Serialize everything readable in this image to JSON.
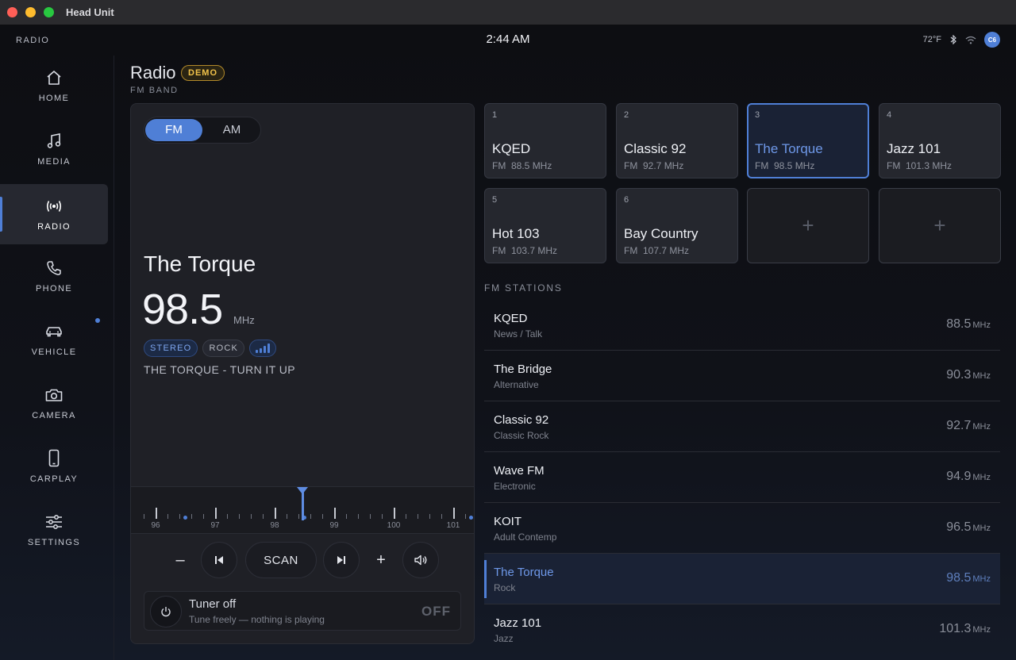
{
  "window": {
    "title": "Head Unit"
  },
  "status": {
    "app": "RADIO",
    "clock": "2:44 AM",
    "temp": "72°F",
    "avatar": "C6"
  },
  "nav": {
    "home": "HOME",
    "media": "MEDIA",
    "radio": "RADIO",
    "phone": "PHONE",
    "vehicle": "VEHICLE",
    "camera": "CAMERA",
    "carplay": "CARPLAY",
    "settings": "SETTINGS",
    "active": "radio"
  },
  "page": {
    "title": "Radio",
    "badge": "DEMO",
    "subtitle": "FM BAND"
  },
  "tuner": {
    "bands": {
      "fm": "FM",
      "am": "AM",
      "selected": "FM"
    },
    "station": "The Torque",
    "frequency": "98.5",
    "unit": "MHz",
    "tags": {
      "stereo": "STEREO",
      "genre": "ROCK"
    },
    "signal_bars": 4,
    "rds": "THE TORQUE - TURN IT UP",
    "dial": {
      "labels": [
        "96",
        "97",
        "98",
        "99",
        "100",
        "101"
      ]
    },
    "controls": {
      "scan": "SCAN",
      "minus": "–",
      "plus": "+"
    },
    "power": {
      "title": "Tuner off",
      "subtitle": "Tune freely — nothing is playing",
      "state": "OFF"
    }
  },
  "presets": [
    {
      "num": "1",
      "name": "KQED",
      "band": "FM",
      "freq": "88.5 MHz",
      "active": false
    },
    {
      "num": "2",
      "name": "Classic 92",
      "band": "FM",
      "freq": "92.7 MHz",
      "active": false
    },
    {
      "num": "3",
      "name": "The Torque",
      "band": "FM",
      "freq": "98.5 MHz",
      "active": true
    },
    {
      "num": "4",
      "name": "Jazz 101",
      "band": "FM",
      "freq": "101.3 MHz",
      "active": false
    },
    {
      "num": "5",
      "name": "Hot 103",
      "band": "FM",
      "freq": "103.7 MHz",
      "active": false
    },
    {
      "num": "6",
      "name": "Bay Country",
      "band": "FM",
      "freq": "107.7 MHz",
      "active": false
    }
  ],
  "empty_preset": {
    "plus": "+"
  },
  "stations": {
    "heading": "FM STATIONS",
    "unit": "MHz",
    "items": [
      {
        "name": "KQED",
        "genre": "News / Talk",
        "freq": "88.5"
      },
      {
        "name": "The Bridge",
        "genre": "Alternative",
        "freq": "90.3"
      },
      {
        "name": "Classic 92",
        "genre": "Classic Rock",
        "freq": "92.7"
      },
      {
        "name": "Wave FM",
        "genre": "Electronic",
        "freq": "94.9"
      },
      {
        "name": "KOIT",
        "genre": "Adult Contemp",
        "freq": "96.5"
      },
      {
        "name": "The Torque",
        "genre": "Rock",
        "freq": "98.5"
      },
      {
        "name": "Jazz 101",
        "genre": "Jazz",
        "freq": "101.3"
      }
    ]
  },
  "colors": {
    "accent": "#4f7fd6",
    "demo": "#f1c24a",
    "background": "#0d0e12"
  }
}
